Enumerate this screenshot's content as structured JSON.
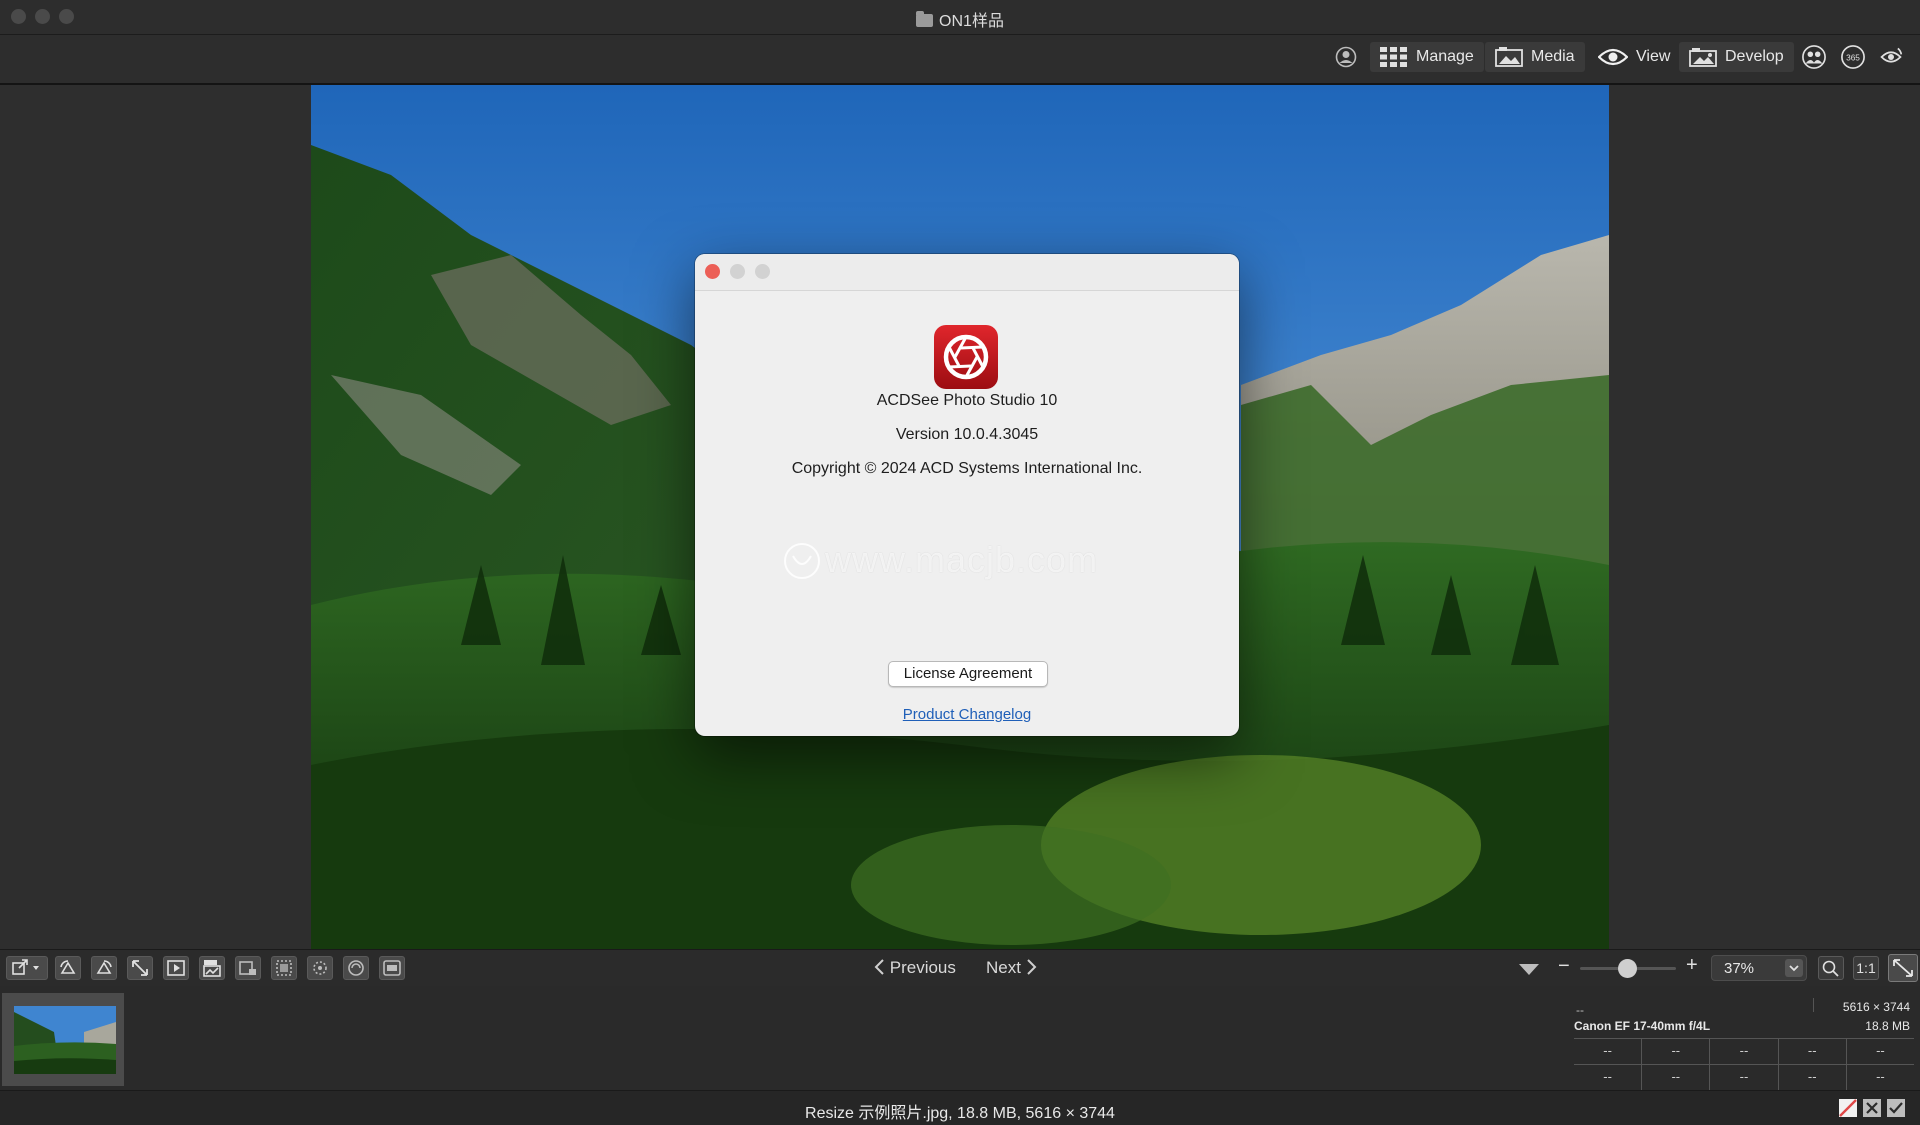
{
  "window": {
    "title": "ON1样品"
  },
  "modules": {
    "manage": "Manage",
    "media": "Media",
    "view": "View",
    "develop": "Develop"
  },
  "about_dialog": {
    "app_name": "ACDSee Photo Studio 10",
    "version": "Version 10.0.4.3045",
    "copyright": "Copyright © 2024 ACD Systems International Inc.",
    "watermark": "www.macjb.com",
    "license_button": "License Agreement",
    "changelog_link": "Product Changelog"
  },
  "navigation": {
    "previous": "Previous",
    "next": "Next"
  },
  "zoom": {
    "minus": "−",
    "plus": "+",
    "level": "37%",
    "one_to_one": "1:1"
  },
  "info": {
    "top_left": "--",
    "dimensions": "5616 × 3744",
    "lens": "Canon EF 17-40mm f/4L",
    "file_size": "18.8 MB",
    "grid_row1": [
      "--",
      "--",
      "--",
      "--",
      "--"
    ],
    "grid_row2": [
      "--",
      "--",
      "--",
      "--",
      "--"
    ]
  },
  "status": {
    "text": "Resize 示例照片.jpg, 18.8 MB, 5616 × 3744"
  },
  "colors": {
    "app_bg": "#2b2b2b",
    "dialog_bg": "#efefef",
    "close_red": "#ec5f57",
    "link_blue": "#1f5fb8",
    "logo_red": "#c0151b"
  }
}
